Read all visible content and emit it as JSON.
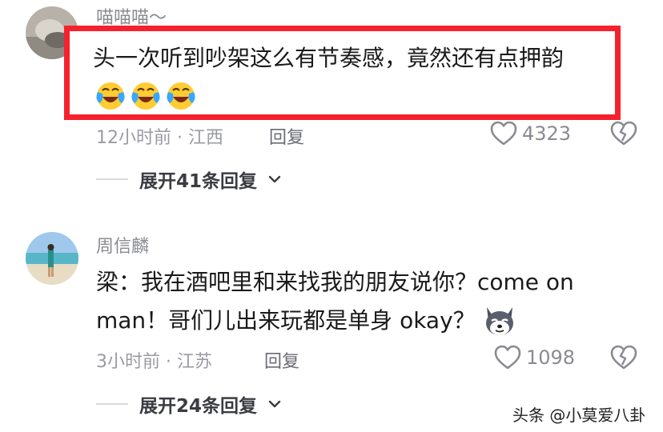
{
  "comments": [
    {
      "username": "喵喵喵～",
      "text": "头一次听到吵架这么有节奏感，竟然还有点押韵",
      "emoji_icon": "crying-laughing-face-icon",
      "meta": "12小时前 · 江西",
      "reply_label": "回复",
      "like_count": "4323",
      "expand_label": "展开41条回复"
    },
    {
      "username": "周信麟",
      "text_line1": "梁：我在酒吧里和来找我的朋友说你？come on",
      "text_line2": "man！哥们儿出来玩都是单身 okay？",
      "emoji_icon": "husky-dog-face-icon",
      "meta": "3小时前 · 江苏",
      "reply_label": "回复",
      "like_count": "1098",
      "expand_label": "展开24条回复"
    }
  ],
  "highlight_color": "#f5222d",
  "watermark": "头条 @小莫爱八卦"
}
